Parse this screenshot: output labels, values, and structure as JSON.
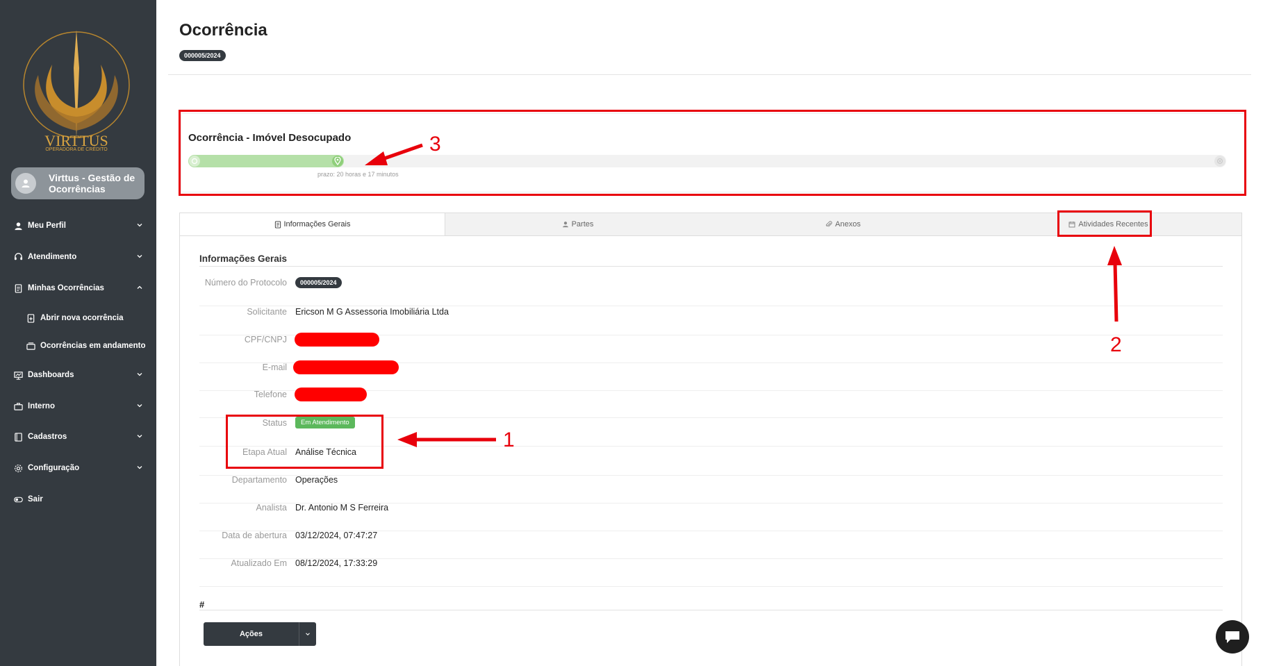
{
  "sidebar": {
    "logo_title": "VIRTTUS",
    "logo_subtitle": "OPERADORA DE CRÉDITO",
    "user_name": "Virttus - Gestão de Ocorrências",
    "items": [
      {
        "label": "Meu Perfil",
        "icon": "user-icon"
      },
      {
        "label": "Atendimento",
        "icon": "headset-icon"
      },
      {
        "label": "Minhas Ocorrências",
        "icon": "document-icon"
      },
      {
        "label": "Abrir nova ocorrência",
        "icon": "file-plus-icon"
      },
      {
        "label": "Ocorrências em andamento",
        "icon": "stack-icon"
      },
      {
        "label": "Dashboards",
        "icon": "monitor-chart-icon"
      },
      {
        "label": "Interno",
        "icon": "briefcase-icon"
      },
      {
        "label": "Cadastros",
        "icon": "book-icon"
      },
      {
        "label": "Configuração",
        "icon": "gear-icon"
      },
      {
        "label": "Sair",
        "icon": "toggle-icon"
      }
    ]
  },
  "header": {
    "title": "Ocorrência",
    "protocol_badge": "000005/2024"
  },
  "workflow": {
    "title": "Ocorrência - Imóvel Desocupado",
    "progress_percent": 15,
    "deadline": "prazo: 20 horas e 17 minutos"
  },
  "tabs": [
    {
      "label": "Informações Gerais",
      "icon": "document-icon",
      "active": true
    },
    {
      "label": "Partes",
      "icon": "user-icon",
      "active": false
    },
    {
      "label": "Anexos",
      "icon": "paperclip-icon",
      "active": false
    },
    {
      "label": "Atividades Recentes",
      "icon": "calendar-icon",
      "active": false
    }
  ],
  "info": {
    "section_title": "Informações Gerais",
    "protocol_label": "Número do Protocolo",
    "protocol_value": "000005/2024",
    "solicitante_label": "Solicitante",
    "solicitante_value": "Ericson M G Assessoria Imobiliária Ltda",
    "cpf_label": "CPF/CNPJ",
    "email_label": "E-mail",
    "telefone_label": "Telefone",
    "status_label": "Status",
    "status_value": "Em Atendimento",
    "etapa_label": "Etapa Atual",
    "etapa_value": "Análise Técnica",
    "departamento_label": "Departamento",
    "departamento_value": "Operações",
    "analista_label": "Analista",
    "analista_value": "Dr. Antonio M S Ferreira",
    "abertura_label": "Data de abertura",
    "abertura_value": "03/12/2024, 07:47:27",
    "atualizado_label": "Atualizado Em",
    "atualizado_value": "08/12/2024, 17:33:29",
    "hash_title": "#",
    "actions_label": "Ações"
  },
  "annotations": {
    "one": "1",
    "two": "2",
    "three": "3"
  },
  "colors": {
    "sidebar_bg": "#343a40",
    "annotation_red": "#e8000b",
    "progress_green": "#b5e0a8",
    "status_green": "#5cb85c"
  }
}
